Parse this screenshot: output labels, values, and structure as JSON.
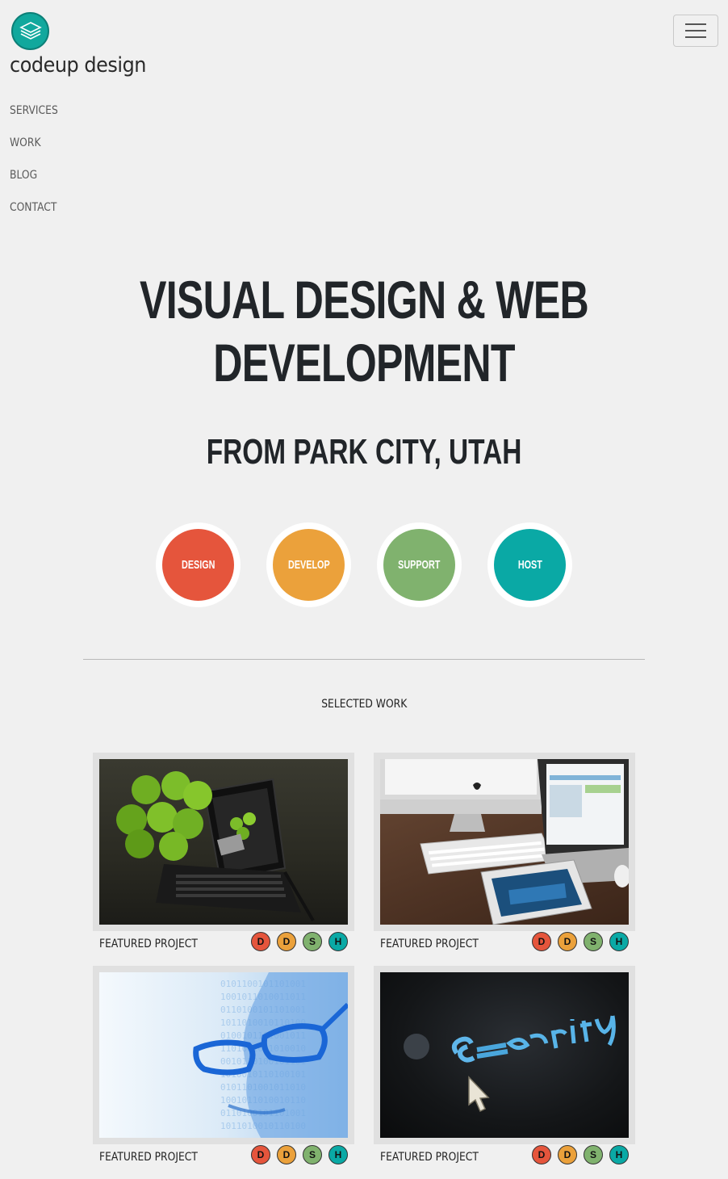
{
  "header": {
    "brand_name": "codeup design",
    "menu_toggle": "hamburger-menu"
  },
  "nav": {
    "items": [
      {
        "label": "SERVICES"
      },
      {
        "label": "WORK"
      },
      {
        "label": "BLOG"
      },
      {
        "label": "CONTACT"
      }
    ]
  },
  "hero": {
    "title_line1": "VISUAL DESIGN & WEB",
    "title_line2": "DEVELOPMENT",
    "subtitle": "FROM PARK CITY, UTAH"
  },
  "services": [
    {
      "label": "DESIGN",
      "color": "#e5553c"
    },
    {
      "label": "DEVELOP",
      "color": "#eba13b"
    },
    {
      "label": "SUPPORT",
      "color": "#80b26e"
    },
    {
      "label": "HOST",
      "color": "#0aa9a5"
    }
  ],
  "work": {
    "title": "SELECTED WORK",
    "projects": [
      {
        "label": "FEATURED PROJECT",
        "image": "tablet-keyboard-green-apples"
      },
      {
        "label": "FEATURED PROJECT",
        "image": "imac-macbook-ipad-desk"
      },
      {
        "label": "FEATURED PROJECT",
        "image": "binary-face-glasses"
      },
      {
        "label": "FEATURED PROJECT",
        "image": "security-screen-cursor"
      }
    ],
    "badges": [
      {
        "letter": "D",
        "color": "#e5553c"
      },
      {
        "letter": "D",
        "color": "#eba13b"
      },
      {
        "letter": "S",
        "color": "#80b26e"
      },
      {
        "letter": "H",
        "color": "#0aa9a5"
      }
    ]
  },
  "colors": {
    "background": "#f0f0f0",
    "brand_teal": "#11a89d"
  }
}
